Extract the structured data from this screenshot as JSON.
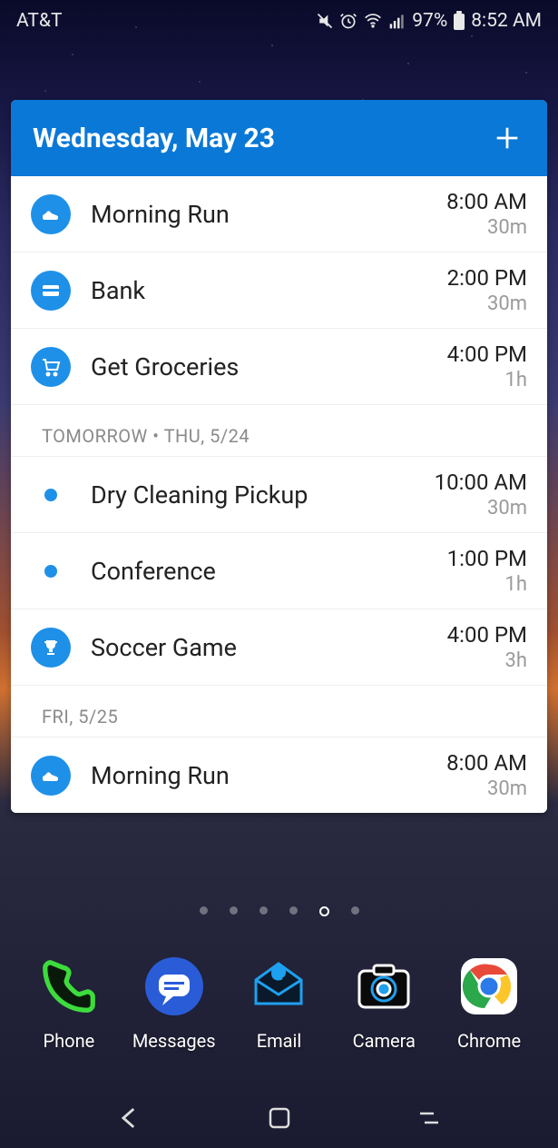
{
  "status": {
    "carrier": "AT&T",
    "battery": "97%",
    "time": "8:52 AM"
  },
  "widget": {
    "title": "Wednesday, May 23"
  },
  "sections": [
    {
      "label": "",
      "events": [
        {
          "icon": "shoe",
          "title": "Morning Run",
          "time": "8:00 AM",
          "duration": "30m"
        },
        {
          "icon": "card",
          "title": "Bank",
          "time": "2:00 PM",
          "duration": "30m"
        },
        {
          "icon": "cart",
          "title": "Get Groceries",
          "time": "4:00 PM",
          "duration": "1h"
        }
      ]
    },
    {
      "label": "TOMORROW • THU, 5/24",
      "events": [
        {
          "icon": "dot",
          "title": "Dry Cleaning Pickup",
          "time": "10:00 AM",
          "duration": "30m"
        },
        {
          "icon": "dot",
          "title": "Conference",
          "time": "1:00 PM",
          "duration": "1h"
        },
        {
          "icon": "trophy",
          "title": "Soccer Game",
          "time": "4:00 PM",
          "duration": "3h"
        }
      ]
    },
    {
      "label": "FRI, 5/25",
      "events": [
        {
          "icon": "shoe",
          "title": "Morning Run",
          "time": "8:00 AM",
          "duration": "30m"
        }
      ]
    }
  ],
  "page_dots": {
    "count": 6,
    "active": 4
  },
  "dock": [
    {
      "name": "Phone",
      "icon": "phone"
    },
    {
      "name": "Messages",
      "icon": "messages"
    },
    {
      "name": "Email",
      "icon": "email"
    },
    {
      "name": "Camera",
      "icon": "camera"
    },
    {
      "name": "Chrome",
      "icon": "chrome"
    }
  ],
  "icons": {
    "mute": "mute-icon",
    "alarm": "alarm-icon",
    "wifi": "wifi-icon",
    "signal": "signal-icon",
    "battery": "battery-icon"
  }
}
